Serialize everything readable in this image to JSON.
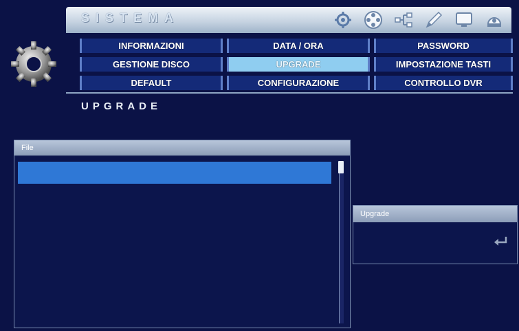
{
  "header": {
    "title": "SISTEMA",
    "icons": [
      "settings-icon",
      "film-reel-icon",
      "network-icon",
      "pencil-icon",
      "monitor-icon",
      "dome-camera-icon"
    ]
  },
  "menu": {
    "items": [
      {
        "label": "INFORMAZIONI"
      },
      {
        "label": "DATA / ORA"
      },
      {
        "label": "PASSWORD"
      },
      {
        "label": "GESTIONE DISCO"
      },
      {
        "label": "UPGRADE",
        "active": true
      },
      {
        "label": "IMPOSTAZIONE TASTI"
      },
      {
        "label": "DEFAULT"
      },
      {
        "label": "CONFIGURAZIONE"
      },
      {
        "label": "CONTROLLO DVR"
      }
    ]
  },
  "section": {
    "title": "UPGRADE"
  },
  "file_panel": {
    "header": "File"
  },
  "upgrade_panel": {
    "header": "Upgrade"
  },
  "colors": {
    "background": "#0b1246",
    "selection": "#2f78d6",
    "active_tab": "#8fcdf0",
    "menu_border": "#5f7fc8"
  }
}
